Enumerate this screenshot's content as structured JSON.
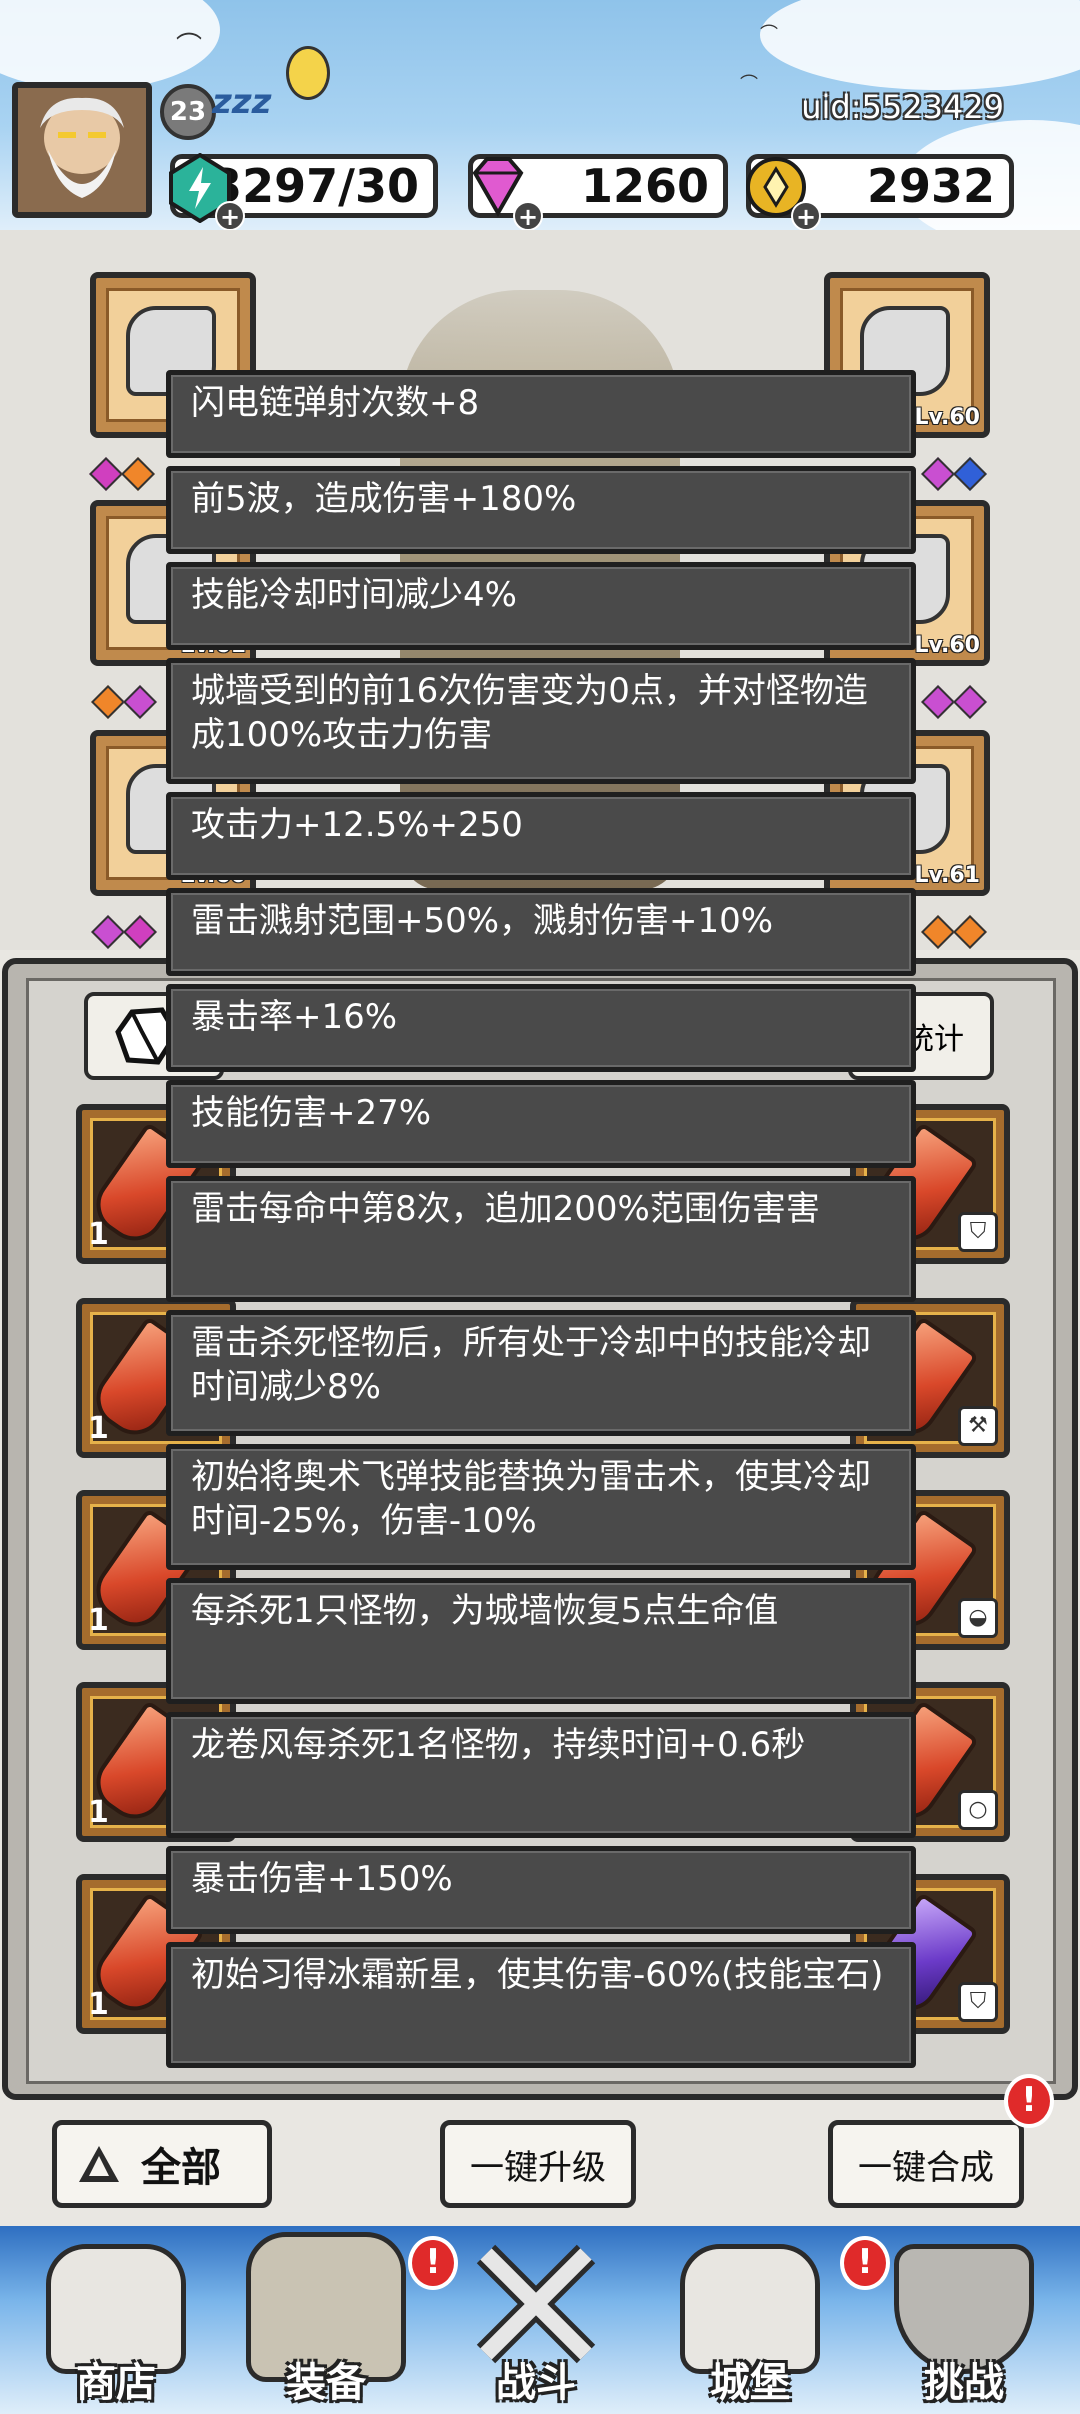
{
  "header": {
    "player_level": "23",
    "sleep_indicator": "zzz",
    "uid": "uid:5523429",
    "resources": [
      {
        "name": "stamina",
        "value": "3297/30",
        "icon": "lightning-gem-icon",
        "color": "#2bb39a"
      },
      {
        "name": "diamonds",
        "value": "1260",
        "icon": "diamond-icon",
        "color": "#e05ad0"
      },
      {
        "name": "gold",
        "value": "2932",
        "icon": "gold-coin-icon",
        "color": "#e8b424"
      }
    ]
  },
  "equipment": {
    "slots": [
      {
        "position": "left-1",
        "level": ""
      },
      {
        "position": "left-2",
        "level": "Lv.61"
      },
      {
        "position": "left-3",
        "level": "Lv.60"
      },
      {
        "position": "right-1",
        "level": "Lv.60"
      },
      {
        "position": "right-2",
        "level": "Lv.60"
      },
      {
        "position": "right-3",
        "level": "Lv.61"
      }
    ]
  },
  "bag": {
    "stats_tab_label": "统计",
    "item_counts": [
      "1",
      "1",
      "1",
      "1",
      "1",
      "1",
      "1"
    ]
  },
  "tooltips": [
    "闪电链弹射次数+8",
    "前5波，造成伤害+180%",
    "技能冷却时间减少4%",
    "城墙受到的前16次伤害变为0点，并对怪物造成100%攻击力伤害",
    "攻击力+12.5%+250",
    "雷击溅射范围+50%，溅射伤害+10%",
    "暴击率+16%",
    "技能伤害+27%",
    "雷击每命中第8次，追加200%范围伤害害",
    "雷击杀死怪物后，所有处于冷却中的技能冷却时间减少8%",
    "初始将奥术飞弹技能替换为雷击术，使其冷却时间-25%，伤害-10%",
    "每杀死1只怪物，为城墙恢复5点生命值",
    "龙卷风每杀死1名怪物，持续时间+0.6秒",
    "暴击伤害+150%",
    "初始习得冰霜新星，使其伤害-60%(技能宝石)"
  ],
  "actions": {
    "all_label": "全部",
    "upgrade_label": "一键升级",
    "merge_label": "一键合成",
    "alert": "!"
  },
  "nav": [
    {
      "label": "商店",
      "icon": "shop-icon",
      "active": false,
      "alert": ""
    },
    {
      "label": "装备",
      "icon": "backpack-icon",
      "active": true,
      "alert": "!"
    },
    {
      "label": "战斗",
      "icon": "crossed-swords-icon",
      "active": false,
      "alert": ""
    },
    {
      "label": "城堡",
      "icon": "castle-icon",
      "active": false,
      "alert": "!"
    },
    {
      "label": "挑战",
      "icon": "shield-icon",
      "active": false,
      "alert": ""
    }
  ]
}
